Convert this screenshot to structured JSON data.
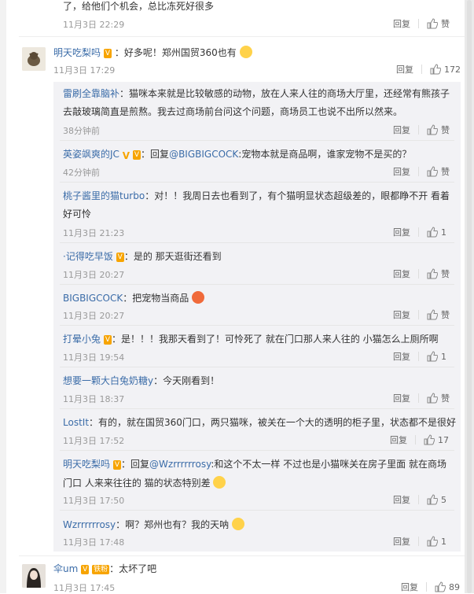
{
  "top": {
    "text": "了，给他们个机会，总比冻死好很多",
    "time": "11月3日 22:29",
    "reply": "回复",
    "like": "赞"
  },
  "main1": {
    "user": "明天吃梨吗",
    "text": "：好多呢！郑州国贸360也有",
    "time": "11月3日 17:29",
    "reply": "回复",
    "likes": "172"
  },
  "subs": [
    {
      "user": "雷刷全靠脑补",
      "text": "：猫咪本来就是比较敏感的动物，放在人来人往的商场大厅里，还经常有熊孩子",
      "text2": "去敲玻璃简直是煎熬。我去过商场前台问这个问题，商场员工也说不出所以然来。",
      "time": "38分钟前",
      "reply": "回复",
      "like": "赞"
    },
    {
      "user": "英姿飒爽的JC",
      "text": "：回复",
      "mention": "@BIGBIGCOCK",
      "text_b": ":宠物本就是商品啊，谁家宠物不是买的？",
      "time": "42分钟前",
      "reply": "回复",
      "like": "赞"
    },
    {
      "user": "桃子酱里的猫turbo",
      "text": "：对！！我周日去也看到了，有个猫明显状态超级差的，眼都睁不开 看着",
      "text2": "好可怜",
      "time": "11月3日 21:23",
      "reply": "回复",
      "like": "1"
    },
    {
      "user": "·记得吃早饭",
      "text": "：是的 那天逛街还看到",
      "time": "11月3日 20:27",
      "reply": "回复",
      "like": "赞"
    },
    {
      "user": "BIGBIGCOCK",
      "text": "：把宠物当商品",
      "time": "11月3日 20:27",
      "reply": "回复",
      "like": "赞"
    },
    {
      "user": "打晕小兔",
      "text": "：是！！！我那天看到了！可怜死了 就在门口那人来人往的 小猫怎么上厕所啊",
      "time": "11月3日 19:54",
      "reply": "回复",
      "like": "1"
    },
    {
      "user": "想要一颗大白兔奶糖y",
      "text": "：今天刚看到！",
      "time": "11月3日 18:37",
      "reply": "回复",
      "like": "赞"
    },
    {
      "user": "LostIt",
      "text": "：有的，就在国贸360门口，两只猫咪，被关在一个大的透明的柜子里，状态都不是很好",
      "time": "11月3日 17:52",
      "reply": "回复",
      "like": "17"
    },
    {
      "user": "明天吃梨吗",
      "text": "：回复",
      "mention": "@Wzrrrrrrosy",
      "text_b": ":和这个不太一样 不过也是小猫咪关在房子里面 就在商场",
      "text2": "门口 人来来往往的 猫的状态特别差",
      "time": "11月3日 17:50",
      "reply": "回复",
      "like": "5"
    },
    {
      "user": "Wzrrrrrrosy",
      "text": "：啊？郑州也有？我的天呐",
      "time": "11月3日 17:48",
      "reply": "回复",
      "like": "1"
    }
  ],
  "main2": {
    "user": "伞um",
    "badge": "铁粉",
    "text": "：太坏了吧",
    "time": "11月3日 17:45",
    "reply": "回复",
    "likes": "89"
  }
}
